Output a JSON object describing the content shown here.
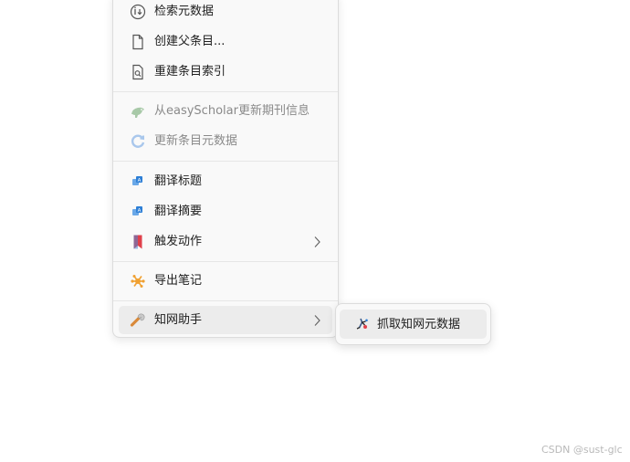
{
  "menu": {
    "items": [
      {
        "label": "检索元数据",
        "icon": "info-download-icon",
        "disabled": false
      },
      {
        "label": "创建父条目...",
        "icon": "document-icon",
        "disabled": false
      },
      {
        "label": "重建条目索引",
        "icon": "document-search-icon",
        "disabled": false
      },
      {
        "label": "从easyScholar更新期刊信息",
        "icon": "easyscholar-icon",
        "disabled": true
      },
      {
        "label": "更新条目元数据",
        "icon": "refresh-icon",
        "disabled": true
      },
      {
        "label": "翻译标题",
        "icon": "translate-icon",
        "disabled": false
      },
      {
        "label": "翻译摘要",
        "icon": "translate-icon",
        "disabled": false
      },
      {
        "label": "触发动作",
        "icon": "bookmark-icon",
        "disabled": false,
        "has_submenu": true
      },
      {
        "label": "导出笔记",
        "icon": "molecule-icon",
        "disabled": false
      },
      {
        "label": "知网助手",
        "icon": "wrench-icon",
        "disabled": false,
        "has_submenu": true,
        "highlighted": true
      }
    ]
  },
  "submenu": {
    "items": [
      {
        "label": "抓取知网元数据",
        "icon": "fetch-icon"
      }
    ]
  },
  "watermark": "CSDN @sust-glc",
  "colors": {
    "menu_bg": "#f9f9f9",
    "highlight": "#ececec",
    "disabled_text": "#8a8a8a",
    "accent_blue": "#2e7fd6",
    "bookmark_red": "#e0404a",
    "orange": "#f0a030"
  }
}
